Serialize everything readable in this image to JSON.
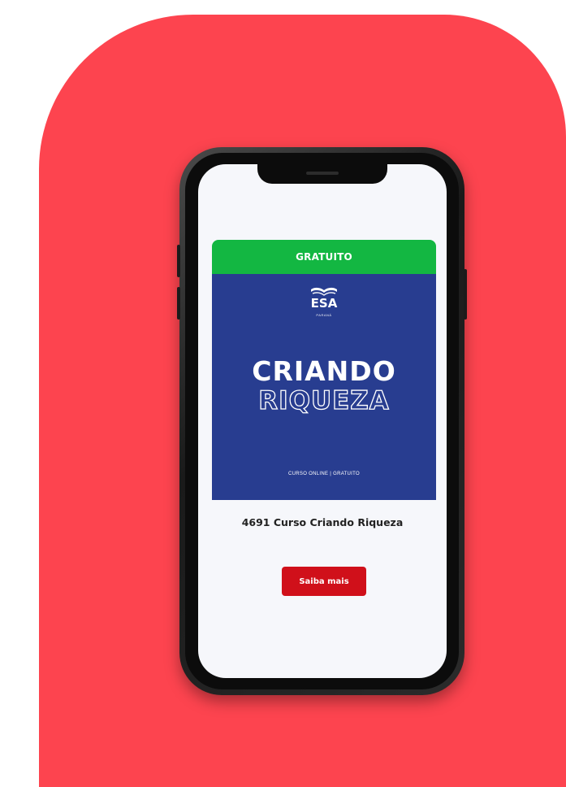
{
  "colors": {
    "background": "#ffffff",
    "panel": "#fd444f",
    "badge": "#13b742",
    "banner": "#283d90",
    "cta": "#d0101a"
  },
  "course_card": {
    "badge_label": "GRATUITO",
    "logo_icon": "open-book-icon",
    "logo_text": "ESA",
    "logo_subtext": "PARANÁ",
    "title_line1": "CRIANDO",
    "title_line2": "RIQUEZA",
    "banner_footer": "CURSO ONLINE | GRATUITO",
    "course_name": "4691 Curso Criando Riqueza",
    "cta_label": "Saiba mais"
  }
}
